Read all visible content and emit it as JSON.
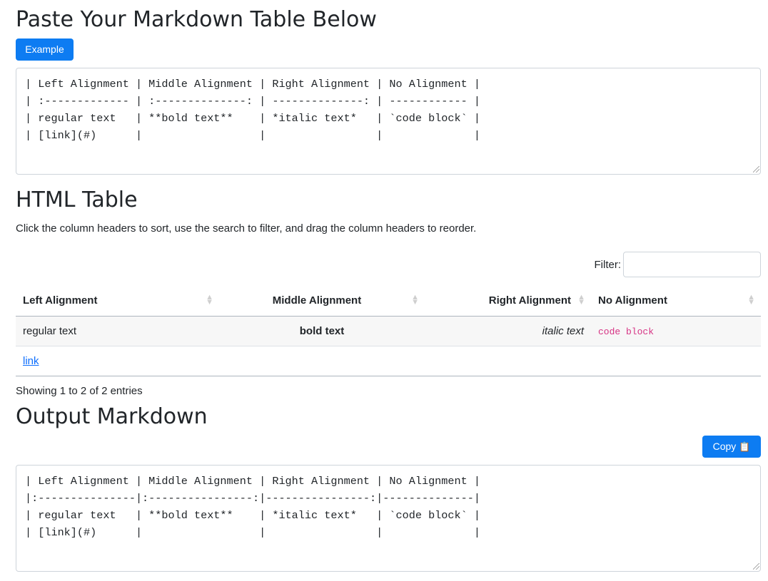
{
  "paste": {
    "heading": "Paste Your Markdown Table Below",
    "example_button": "Example",
    "input_text": "| Left Alignment | Middle Alignment | Right Alignment | No Alignment |\n| :------------- | :--------------: | --------------: | ------------ |\n| regular text   | **bold text**    | *italic text*   | `code block` |\n| [link](#)      |                  |                 |              |"
  },
  "html_table": {
    "heading": "HTML Table",
    "description": "Click the column headers to sort, use the search to filter, and drag the column headers to reorder.",
    "filter_label": "Filter:",
    "filter_value": "",
    "columns": [
      "Left Alignment",
      "Middle Alignment",
      "Right Alignment",
      "No Alignment"
    ],
    "rows": [
      {
        "left": "regular text",
        "middle": "bold text",
        "right": "italic text",
        "none": "code block"
      },
      {
        "left": "link",
        "middle": "",
        "right": "",
        "none": ""
      }
    ],
    "info": "Showing 1 to 2 of 2 entries"
  },
  "output": {
    "heading": "Output Markdown",
    "copy_button": "Copy",
    "copy_icon": "clipboard-icon",
    "output_text": "| Left Alignment | Middle Alignment | Right Alignment | No Alignment |\n|:---------------|:----------------:|----------------:|--------------|\n| regular text   | **bold text**    | *italic text*   | `code block` |\n| [link](#)      |                  |                 |              |"
  },
  "colors": {
    "primary": "#0d7cf2",
    "code": "#d63384",
    "link": "#0d6efd"
  }
}
